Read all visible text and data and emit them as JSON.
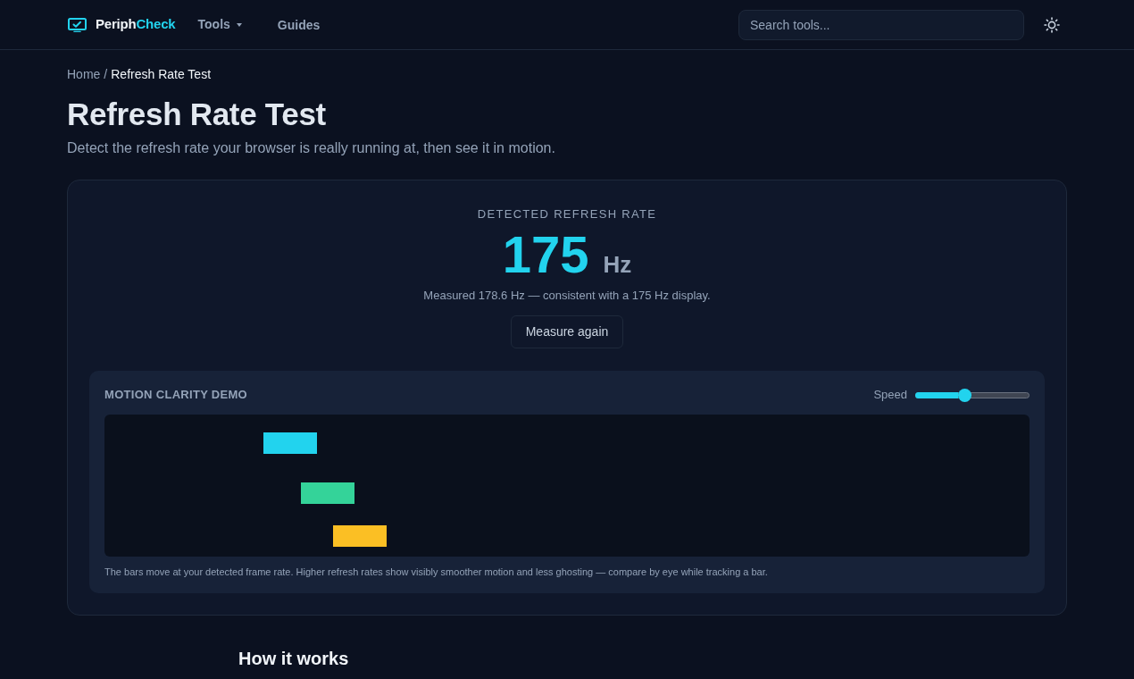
{
  "header": {
    "logo": {
      "part_1": "Periph",
      "part_2": "Check"
    },
    "nav": [
      {
        "label": "Tools",
        "kind": "dropdown"
      },
      {
        "label": "Guides",
        "kind": "link"
      }
    ],
    "search": {
      "placeholder": "Search tools..."
    }
  },
  "breadcrumb": {
    "items": [
      "Home",
      "Refresh Rate Test"
    ],
    "separator": "/"
  },
  "page": {
    "title": "Refresh Rate Test",
    "subtitle": "Detect the refresh rate your browser is really running at, then see it in motion."
  },
  "result": {
    "label": "DETECTED REFRESH RATE",
    "value": "175",
    "unit": "Hz",
    "detail": "Measured 178.6 Hz — consistent with a 175 Hz display.",
    "button": "Measure again"
  },
  "demo": {
    "title": "MOTION CLARITY DEMO",
    "speed": {
      "label": "Speed",
      "level": 0.43
    },
    "bars": [
      {
        "color": "#22d3ee"
      },
      {
        "color": "#34d399"
      },
      {
        "color": "#fbbf24"
      }
    ],
    "caption": "The bars move at your detected frame rate. Higher refresh rates show visibly smoother motion and less ghosting — compare by eye while tracking a bar."
  },
  "section": {
    "title": "How it works"
  }
}
